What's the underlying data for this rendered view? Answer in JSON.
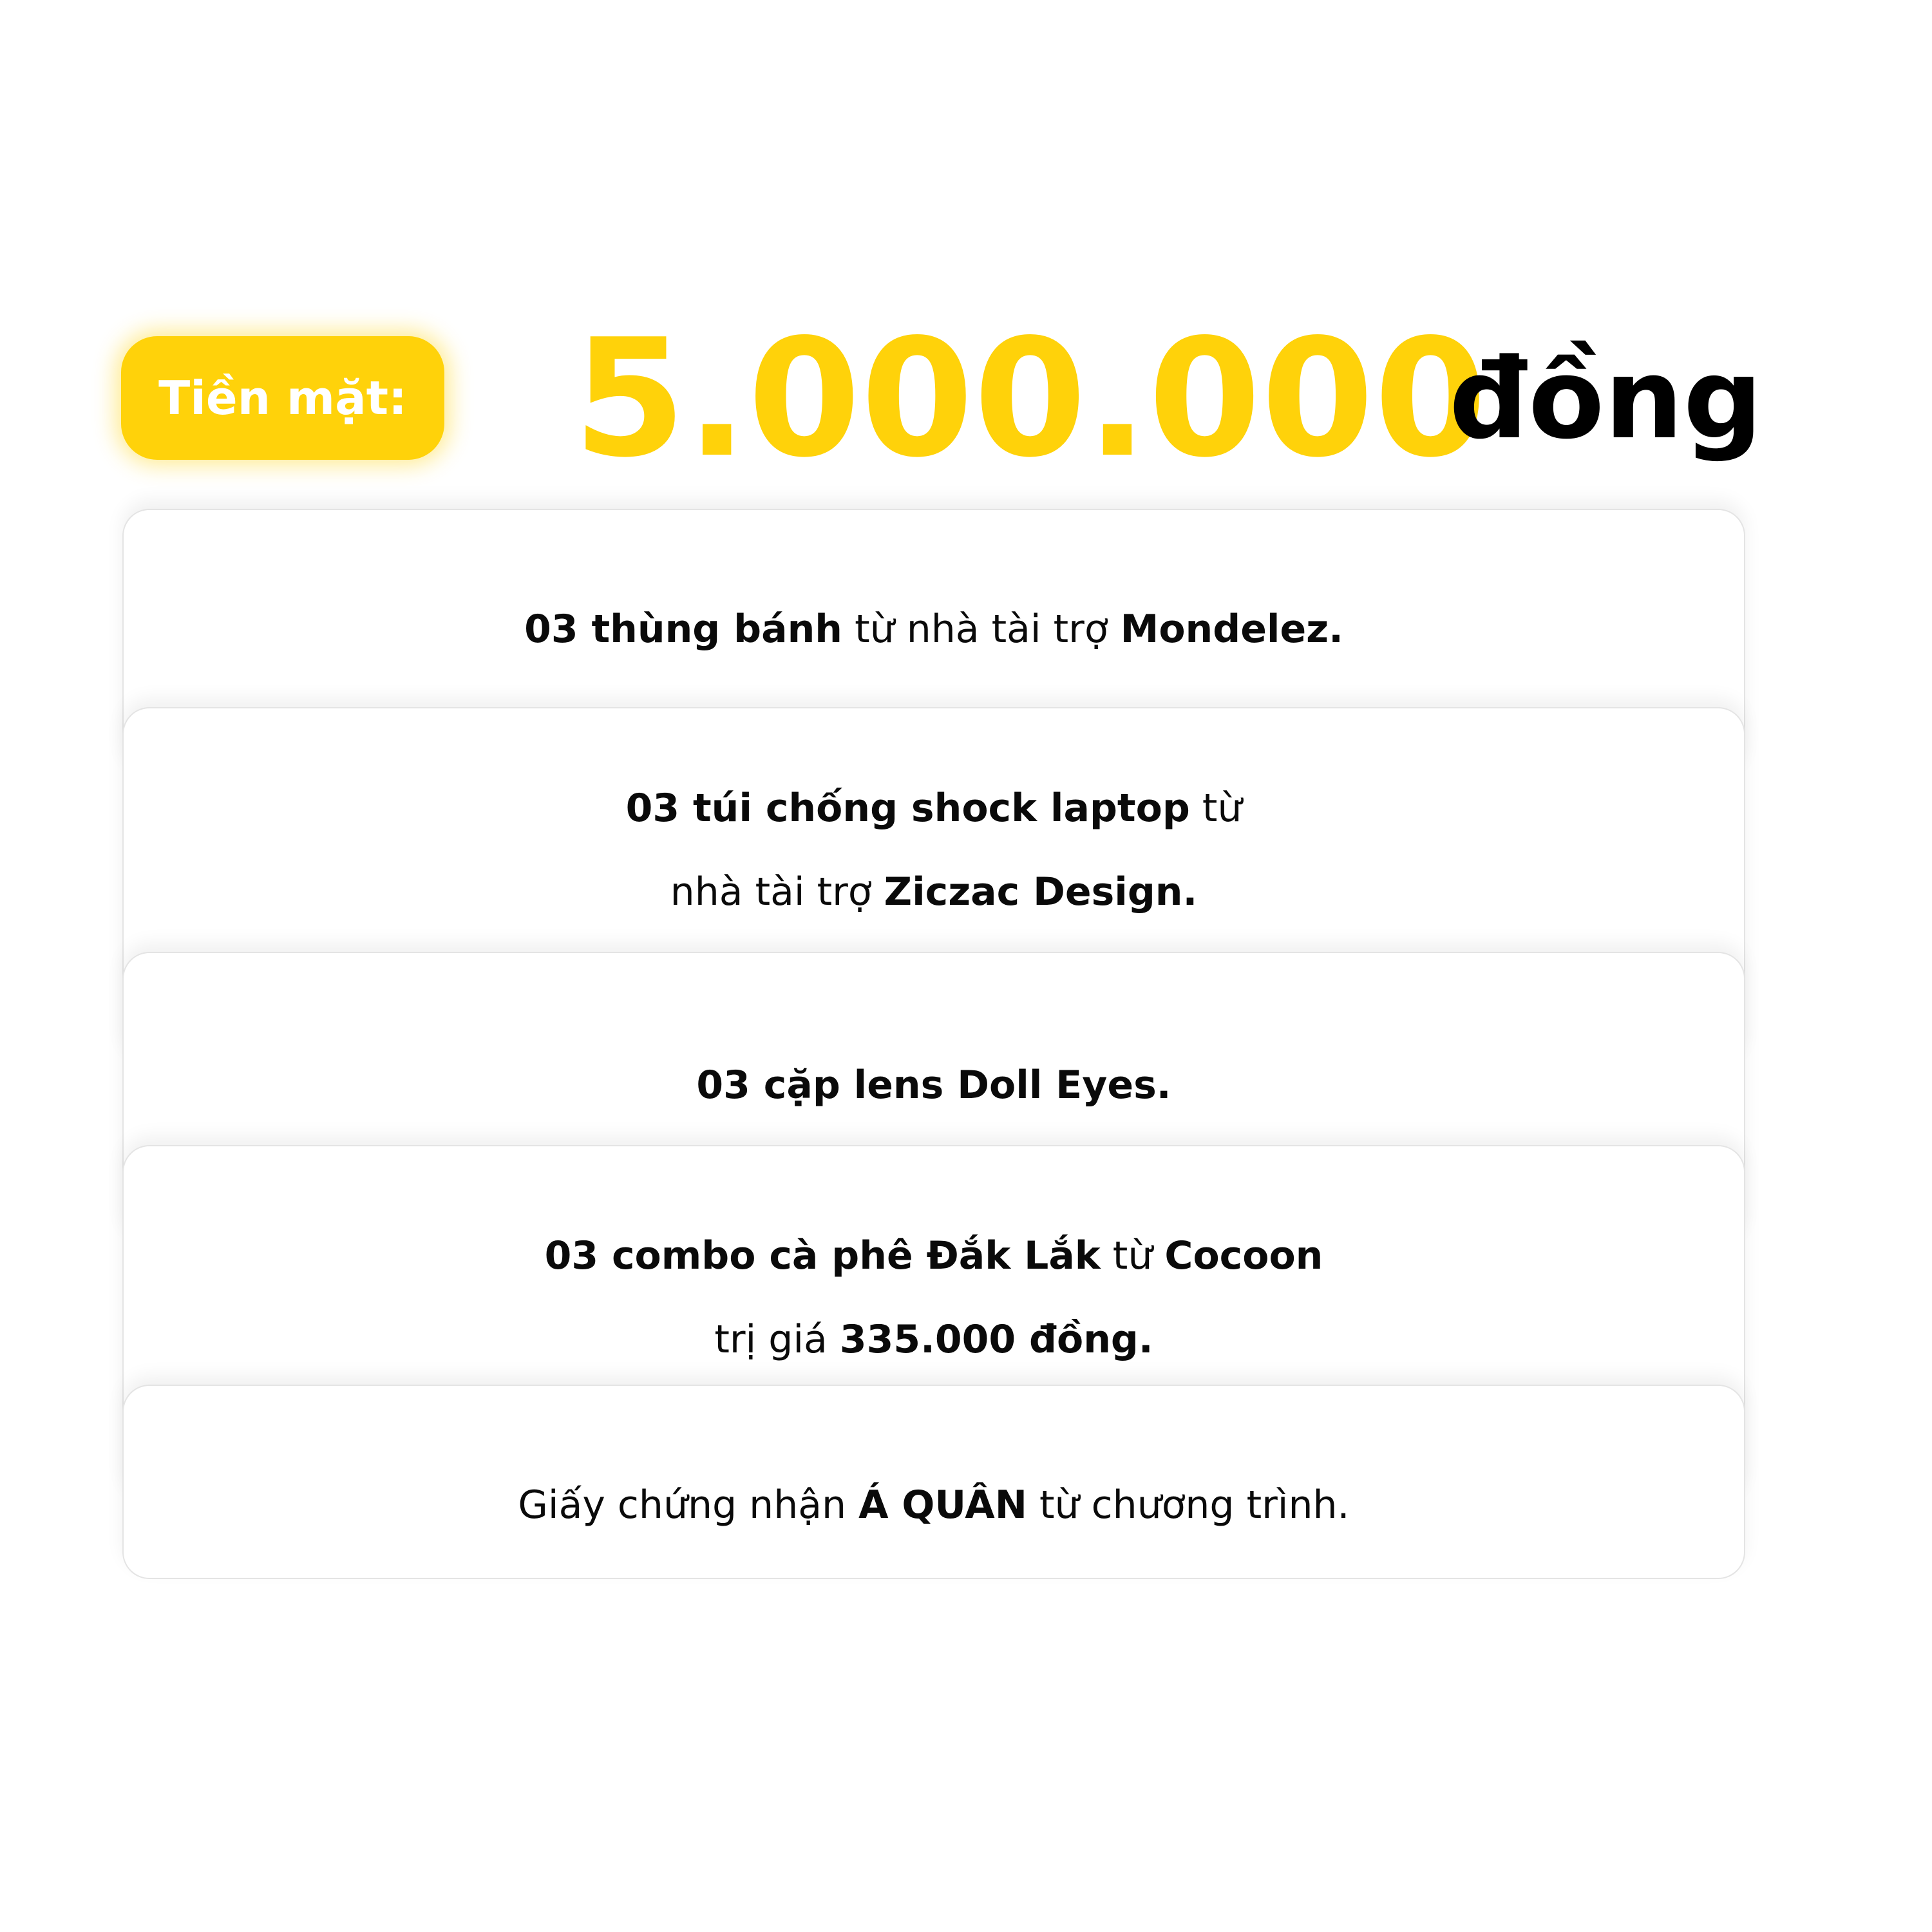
{
  "header": {
    "badge_label": "Tiền mặt:",
    "amount": "5.000.000",
    "currency": "đồng"
  },
  "prizes": [
    {
      "lines": [
        [
          {
            "text": "03 thùng bánh",
            "bold": true
          },
          {
            "text": " từ nhà tài trợ ",
            "bold": false
          },
          {
            "text": "Mondelez.",
            "bold": true
          }
        ]
      ]
    },
    {
      "lines": [
        [
          {
            "text": "03 túi chống shock laptop",
            "bold": true
          },
          {
            "text": " từ",
            "bold": false
          }
        ],
        [
          {
            "text": "nhà tài trợ ",
            "bold": false
          },
          {
            "text": "Ziczac Design.",
            "bold": true
          }
        ]
      ]
    },
    {
      "lines": [
        [
          {
            "text": "03 cặp lens Doll Eyes.",
            "bold": true
          }
        ]
      ]
    },
    {
      "lines": [
        [
          {
            "text": "03 combo cà phê Đắk Lắk",
            "bold": true
          },
          {
            "text": " từ ",
            "bold": false
          },
          {
            "text": "Cocoon",
            "bold": true
          }
        ],
        [
          {
            "text": "trị giá ",
            "bold": false
          },
          {
            "text": "335.000 đồng.",
            "bold": true
          }
        ]
      ]
    },
    {
      "lines": [
        [
          {
            "text": "Giấy chứng nhận ",
            "bold": false
          },
          {
            "text": "Á QUÂN",
            "bold": true
          },
          {
            "text": " từ chương trình.",
            "bold": false
          }
        ]
      ]
    }
  ],
  "colors": {
    "accent": "#FFD20A",
    "text": "#000000",
    "background": "#ffffff"
  }
}
